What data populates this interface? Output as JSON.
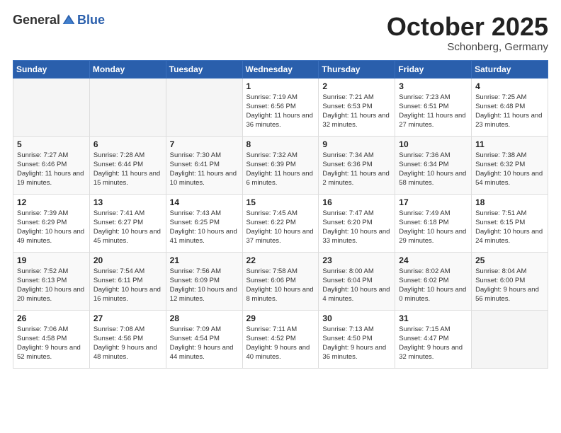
{
  "logo": {
    "general": "General",
    "blue": "Blue"
  },
  "header": {
    "month": "October 2025",
    "location": "Schonberg, Germany"
  },
  "weekdays": [
    "Sunday",
    "Monday",
    "Tuesday",
    "Wednesday",
    "Thursday",
    "Friday",
    "Saturday"
  ],
  "weeks": [
    [
      {
        "day": "",
        "info": ""
      },
      {
        "day": "",
        "info": ""
      },
      {
        "day": "",
        "info": ""
      },
      {
        "day": "1",
        "info": "Sunrise: 7:19 AM\nSunset: 6:56 PM\nDaylight: 11 hours\nand 36 minutes."
      },
      {
        "day": "2",
        "info": "Sunrise: 7:21 AM\nSunset: 6:53 PM\nDaylight: 11 hours\nand 32 minutes."
      },
      {
        "day": "3",
        "info": "Sunrise: 7:23 AM\nSunset: 6:51 PM\nDaylight: 11 hours\nand 27 minutes."
      },
      {
        "day": "4",
        "info": "Sunrise: 7:25 AM\nSunset: 6:48 PM\nDaylight: 11 hours\nand 23 minutes."
      }
    ],
    [
      {
        "day": "5",
        "info": "Sunrise: 7:27 AM\nSunset: 6:46 PM\nDaylight: 11 hours\nand 19 minutes."
      },
      {
        "day": "6",
        "info": "Sunrise: 7:28 AM\nSunset: 6:44 PM\nDaylight: 11 hours\nand 15 minutes."
      },
      {
        "day": "7",
        "info": "Sunrise: 7:30 AM\nSunset: 6:41 PM\nDaylight: 11 hours\nand 10 minutes."
      },
      {
        "day": "8",
        "info": "Sunrise: 7:32 AM\nSunset: 6:39 PM\nDaylight: 11 hours\nand 6 minutes."
      },
      {
        "day": "9",
        "info": "Sunrise: 7:34 AM\nSunset: 6:36 PM\nDaylight: 11 hours\nand 2 minutes."
      },
      {
        "day": "10",
        "info": "Sunrise: 7:36 AM\nSunset: 6:34 PM\nDaylight: 10 hours\nand 58 minutes."
      },
      {
        "day": "11",
        "info": "Sunrise: 7:38 AM\nSunset: 6:32 PM\nDaylight: 10 hours\nand 54 minutes."
      }
    ],
    [
      {
        "day": "12",
        "info": "Sunrise: 7:39 AM\nSunset: 6:29 PM\nDaylight: 10 hours\nand 49 minutes."
      },
      {
        "day": "13",
        "info": "Sunrise: 7:41 AM\nSunset: 6:27 PM\nDaylight: 10 hours\nand 45 minutes."
      },
      {
        "day": "14",
        "info": "Sunrise: 7:43 AM\nSunset: 6:25 PM\nDaylight: 10 hours\nand 41 minutes."
      },
      {
        "day": "15",
        "info": "Sunrise: 7:45 AM\nSunset: 6:22 PM\nDaylight: 10 hours\nand 37 minutes."
      },
      {
        "day": "16",
        "info": "Sunrise: 7:47 AM\nSunset: 6:20 PM\nDaylight: 10 hours\nand 33 minutes."
      },
      {
        "day": "17",
        "info": "Sunrise: 7:49 AM\nSunset: 6:18 PM\nDaylight: 10 hours\nand 29 minutes."
      },
      {
        "day": "18",
        "info": "Sunrise: 7:51 AM\nSunset: 6:15 PM\nDaylight: 10 hours\nand 24 minutes."
      }
    ],
    [
      {
        "day": "19",
        "info": "Sunrise: 7:52 AM\nSunset: 6:13 PM\nDaylight: 10 hours\nand 20 minutes."
      },
      {
        "day": "20",
        "info": "Sunrise: 7:54 AM\nSunset: 6:11 PM\nDaylight: 10 hours\nand 16 minutes."
      },
      {
        "day": "21",
        "info": "Sunrise: 7:56 AM\nSunset: 6:09 PM\nDaylight: 10 hours\nand 12 minutes."
      },
      {
        "day": "22",
        "info": "Sunrise: 7:58 AM\nSunset: 6:06 PM\nDaylight: 10 hours\nand 8 minutes."
      },
      {
        "day": "23",
        "info": "Sunrise: 8:00 AM\nSunset: 6:04 PM\nDaylight: 10 hours\nand 4 minutes."
      },
      {
        "day": "24",
        "info": "Sunrise: 8:02 AM\nSunset: 6:02 PM\nDaylight: 10 hours\nand 0 minutes."
      },
      {
        "day": "25",
        "info": "Sunrise: 8:04 AM\nSunset: 6:00 PM\nDaylight: 9 hours\nand 56 minutes."
      }
    ],
    [
      {
        "day": "26",
        "info": "Sunrise: 7:06 AM\nSunset: 4:58 PM\nDaylight: 9 hours\nand 52 minutes."
      },
      {
        "day": "27",
        "info": "Sunrise: 7:08 AM\nSunset: 4:56 PM\nDaylight: 9 hours\nand 48 minutes."
      },
      {
        "day": "28",
        "info": "Sunrise: 7:09 AM\nSunset: 4:54 PM\nDaylight: 9 hours\nand 44 minutes."
      },
      {
        "day": "29",
        "info": "Sunrise: 7:11 AM\nSunset: 4:52 PM\nDaylight: 9 hours\nand 40 minutes."
      },
      {
        "day": "30",
        "info": "Sunrise: 7:13 AM\nSunset: 4:50 PM\nDaylight: 9 hours\nand 36 minutes."
      },
      {
        "day": "31",
        "info": "Sunrise: 7:15 AM\nSunset: 4:47 PM\nDaylight: 9 hours\nand 32 minutes."
      },
      {
        "day": "",
        "info": ""
      }
    ]
  ]
}
